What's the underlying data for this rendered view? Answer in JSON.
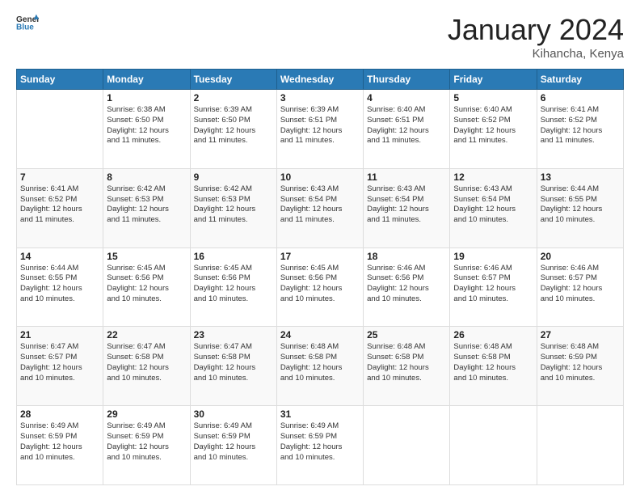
{
  "header": {
    "logo_general": "General",
    "logo_blue": "Blue",
    "month_title": "January 2024",
    "location": "Kihancha, Kenya"
  },
  "days_of_week": [
    "Sunday",
    "Monday",
    "Tuesday",
    "Wednesday",
    "Thursday",
    "Friday",
    "Saturday"
  ],
  "weeks": [
    [
      {
        "day": "",
        "sunrise": "",
        "sunset": "",
        "daylight": ""
      },
      {
        "day": "1",
        "sunrise": "6:38 AM",
        "sunset": "6:50 PM",
        "daylight": "12 hours and 11 minutes."
      },
      {
        "day": "2",
        "sunrise": "6:39 AM",
        "sunset": "6:50 PM",
        "daylight": "12 hours and 11 minutes."
      },
      {
        "day": "3",
        "sunrise": "6:39 AM",
        "sunset": "6:51 PM",
        "daylight": "12 hours and 11 minutes."
      },
      {
        "day": "4",
        "sunrise": "6:40 AM",
        "sunset": "6:51 PM",
        "daylight": "12 hours and 11 minutes."
      },
      {
        "day": "5",
        "sunrise": "6:40 AM",
        "sunset": "6:52 PM",
        "daylight": "12 hours and 11 minutes."
      },
      {
        "day": "6",
        "sunrise": "6:41 AM",
        "sunset": "6:52 PM",
        "daylight": "12 hours and 11 minutes."
      }
    ],
    [
      {
        "day": "7",
        "sunrise": "6:41 AM",
        "sunset": "6:52 PM",
        "daylight": "12 hours and 11 minutes."
      },
      {
        "day": "8",
        "sunrise": "6:42 AM",
        "sunset": "6:53 PM",
        "daylight": "12 hours and 11 minutes."
      },
      {
        "day": "9",
        "sunrise": "6:42 AM",
        "sunset": "6:53 PM",
        "daylight": "12 hours and 11 minutes."
      },
      {
        "day": "10",
        "sunrise": "6:43 AM",
        "sunset": "6:54 PM",
        "daylight": "12 hours and 11 minutes."
      },
      {
        "day": "11",
        "sunrise": "6:43 AM",
        "sunset": "6:54 PM",
        "daylight": "12 hours and 11 minutes."
      },
      {
        "day": "12",
        "sunrise": "6:43 AM",
        "sunset": "6:54 PM",
        "daylight": "12 hours and 10 minutes."
      },
      {
        "day": "13",
        "sunrise": "6:44 AM",
        "sunset": "6:55 PM",
        "daylight": "12 hours and 10 minutes."
      }
    ],
    [
      {
        "day": "14",
        "sunrise": "6:44 AM",
        "sunset": "6:55 PM",
        "daylight": "12 hours and 10 minutes."
      },
      {
        "day": "15",
        "sunrise": "6:45 AM",
        "sunset": "6:56 PM",
        "daylight": "12 hours and 10 minutes."
      },
      {
        "day": "16",
        "sunrise": "6:45 AM",
        "sunset": "6:56 PM",
        "daylight": "12 hours and 10 minutes."
      },
      {
        "day": "17",
        "sunrise": "6:45 AM",
        "sunset": "6:56 PM",
        "daylight": "12 hours and 10 minutes."
      },
      {
        "day": "18",
        "sunrise": "6:46 AM",
        "sunset": "6:56 PM",
        "daylight": "12 hours and 10 minutes."
      },
      {
        "day": "19",
        "sunrise": "6:46 AM",
        "sunset": "6:57 PM",
        "daylight": "12 hours and 10 minutes."
      },
      {
        "day": "20",
        "sunrise": "6:46 AM",
        "sunset": "6:57 PM",
        "daylight": "12 hours and 10 minutes."
      }
    ],
    [
      {
        "day": "21",
        "sunrise": "6:47 AM",
        "sunset": "6:57 PM",
        "daylight": "12 hours and 10 minutes."
      },
      {
        "day": "22",
        "sunrise": "6:47 AM",
        "sunset": "6:58 PM",
        "daylight": "12 hours and 10 minutes."
      },
      {
        "day": "23",
        "sunrise": "6:47 AM",
        "sunset": "6:58 PM",
        "daylight": "12 hours and 10 minutes."
      },
      {
        "day": "24",
        "sunrise": "6:48 AM",
        "sunset": "6:58 PM",
        "daylight": "12 hours and 10 minutes."
      },
      {
        "day": "25",
        "sunrise": "6:48 AM",
        "sunset": "6:58 PM",
        "daylight": "12 hours and 10 minutes."
      },
      {
        "day": "26",
        "sunrise": "6:48 AM",
        "sunset": "6:58 PM",
        "daylight": "12 hours and 10 minutes."
      },
      {
        "day": "27",
        "sunrise": "6:48 AM",
        "sunset": "6:59 PM",
        "daylight": "12 hours and 10 minutes."
      }
    ],
    [
      {
        "day": "28",
        "sunrise": "6:49 AM",
        "sunset": "6:59 PM",
        "daylight": "12 hours and 10 minutes."
      },
      {
        "day": "29",
        "sunrise": "6:49 AM",
        "sunset": "6:59 PM",
        "daylight": "12 hours and 10 minutes."
      },
      {
        "day": "30",
        "sunrise": "6:49 AM",
        "sunset": "6:59 PM",
        "daylight": "12 hours and 10 minutes."
      },
      {
        "day": "31",
        "sunrise": "6:49 AM",
        "sunset": "6:59 PM",
        "daylight": "12 hours and 10 minutes."
      },
      {
        "day": "",
        "sunrise": "",
        "sunset": "",
        "daylight": ""
      },
      {
        "day": "",
        "sunrise": "",
        "sunset": "",
        "daylight": ""
      },
      {
        "day": "",
        "sunrise": "",
        "sunset": "",
        "daylight": ""
      }
    ]
  ],
  "labels": {
    "sunrise_prefix": "Sunrise: ",
    "sunset_prefix": "Sunset: ",
    "daylight_prefix": "Daylight: "
  }
}
